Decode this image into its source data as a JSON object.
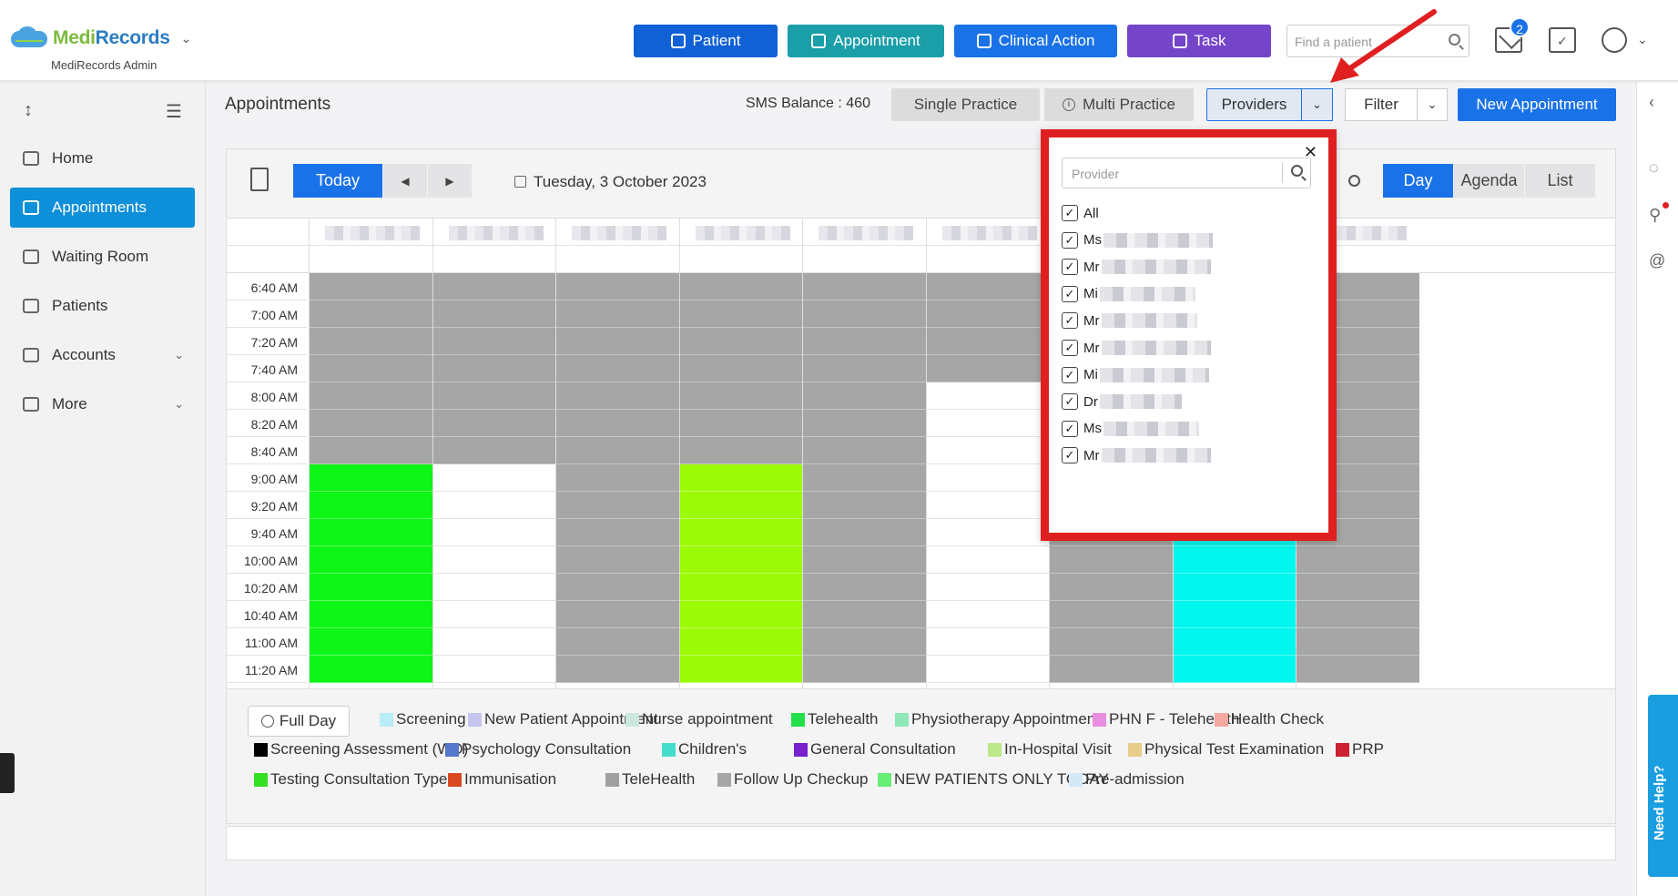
{
  "app": {
    "brand_part1": "Medi",
    "brand_part2": "Records",
    "subtitle": "MediRecords Admin"
  },
  "topbar": {
    "buttons": [
      {
        "label": "Patient",
        "icon": "person-add-icon",
        "color": "#1060d6"
      },
      {
        "label": "Appointment",
        "icon": "calendar-plus-icon",
        "color": "#1a9ea8"
      },
      {
        "label": "Clinical Action",
        "icon": "medical-kit-icon",
        "color": "#1a72e8"
      },
      {
        "label": "Task",
        "icon": "clipboard-icon",
        "color": "#7444c9"
      }
    ],
    "search_placeholder": "Find a patient",
    "mail_badge": "2"
  },
  "sidebar": {
    "items": [
      {
        "label": "Home",
        "icon": "home-icon"
      },
      {
        "label": "Appointments",
        "icon": "calendar-icon",
        "active": true
      },
      {
        "label": "Waiting Room",
        "icon": "people-icon"
      },
      {
        "label": "Patients",
        "icon": "patients-icon"
      },
      {
        "label": "Accounts",
        "icon": "folder-icon"
      },
      {
        "label": "More",
        "icon": "folder-icon"
      }
    ]
  },
  "header": {
    "title": "Appointments",
    "sms_balance": "SMS Balance : 460",
    "single_practice": "Single Practice",
    "multi_practice": "Multi Practice",
    "providers": "Providers",
    "filter": "Filter",
    "new_appointment": "New Appointment"
  },
  "toolbar": {
    "today": "Today",
    "date": "Tuesday, 3 October 2023",
    "views": [
      "Day",
      "Agenda",
      "List"
    ],
    "active_view": "Day"
  },
  "calendar": {
    "times": [
      "6:40 AM",
      "7:00 AM",
      "7:20 AM",
      "7:40 AM",
      "8:00 AM",
      "8:20 AM",
      "8:40 AM",
      "9:00 AM",
      "9:20 AM",
      "9:40 AM",
      "10:00 AM",
      "10:20 AM",
      "10:40 AM",
      "11:00 AM",
      "11:20 AM"
    ],
    "colors": {
      "unavailable": "#a6a6a6",
      "open": "#ffffff",
      "green": "#0ef517",
      "lime": "#9bfa05",
      "cyan": "#00f7ee"
    }
  },
  "legend": {
    "full_day": "Full Day",
    "items": [
      {
        "label": "Screening",
        "color": "#b8ecf7"
      },
      {
        "label": "New Patient Appointment",
        "color": "#c5c5f0"
      },
      {
        "label": "Nurse appointment",
        "color": "#cbe8e0"
      },
      {
        "label": "Telehealth",
        "color": "#23e04a"
      },
      {
        "label": "Physiotherapy Appointment",
        "color": "#8fe8b8"
      },
      {
        "label": "PHN F - Telehealth",
        "color": "#e88fe0"
      },
      {
        "label": "Health Check",
        "color": "#f5a8a0"
      },
      {
        "label": "Screening Assessment (WD)",
        "color": "#000000"
      },
      {
        "label": "Psychology Consultation",
        "color": "#5577cc"
      },
      {
        "label": "Children's",
        "color": "#44ddcc"
      },
      {
        "label": "General Consultation",
        "color": "#7722cc"
      },
      {
        "label": "In-Hospital Visit",
        "color": "#bde88a"
      },
      {
        "label": "Physical Test Examination",
        "color": "#e8cc88"
      },
      {
        "label": "PRP",
        "color": "#cc2233"
      },
      {
        "label": "Testing Consultation Type",
        "color": "#33e022"
      },
      {
        "label": "Immunisation",
        "color": "#d94a22"
      },
      {
        "label": "TeleHealth",
        "color": "#a0a0a0"
      },
      {
        "label": "Follow Up Checkup",
        "color": "#a6a6a6"
      },
      {
        "label": "NEW PATIENTS ONLY TODAY",
        "color": "#66ee77"
      },
      {
        "label": "Pre-admission",
        "color": "#d5e8f5"
      }
    ]
  },
  "provider_dropdown": {
    "search_placeholder": "Provider",
    "items": [
      "All",
      "Ms",
      "Mr",
      "Mi",
      "Mr",
      "Mr",
      "Mi",
      "Dr",
      "Ms",
      "Mr"
    ]
  },
  "help": "Need Help?"
}
